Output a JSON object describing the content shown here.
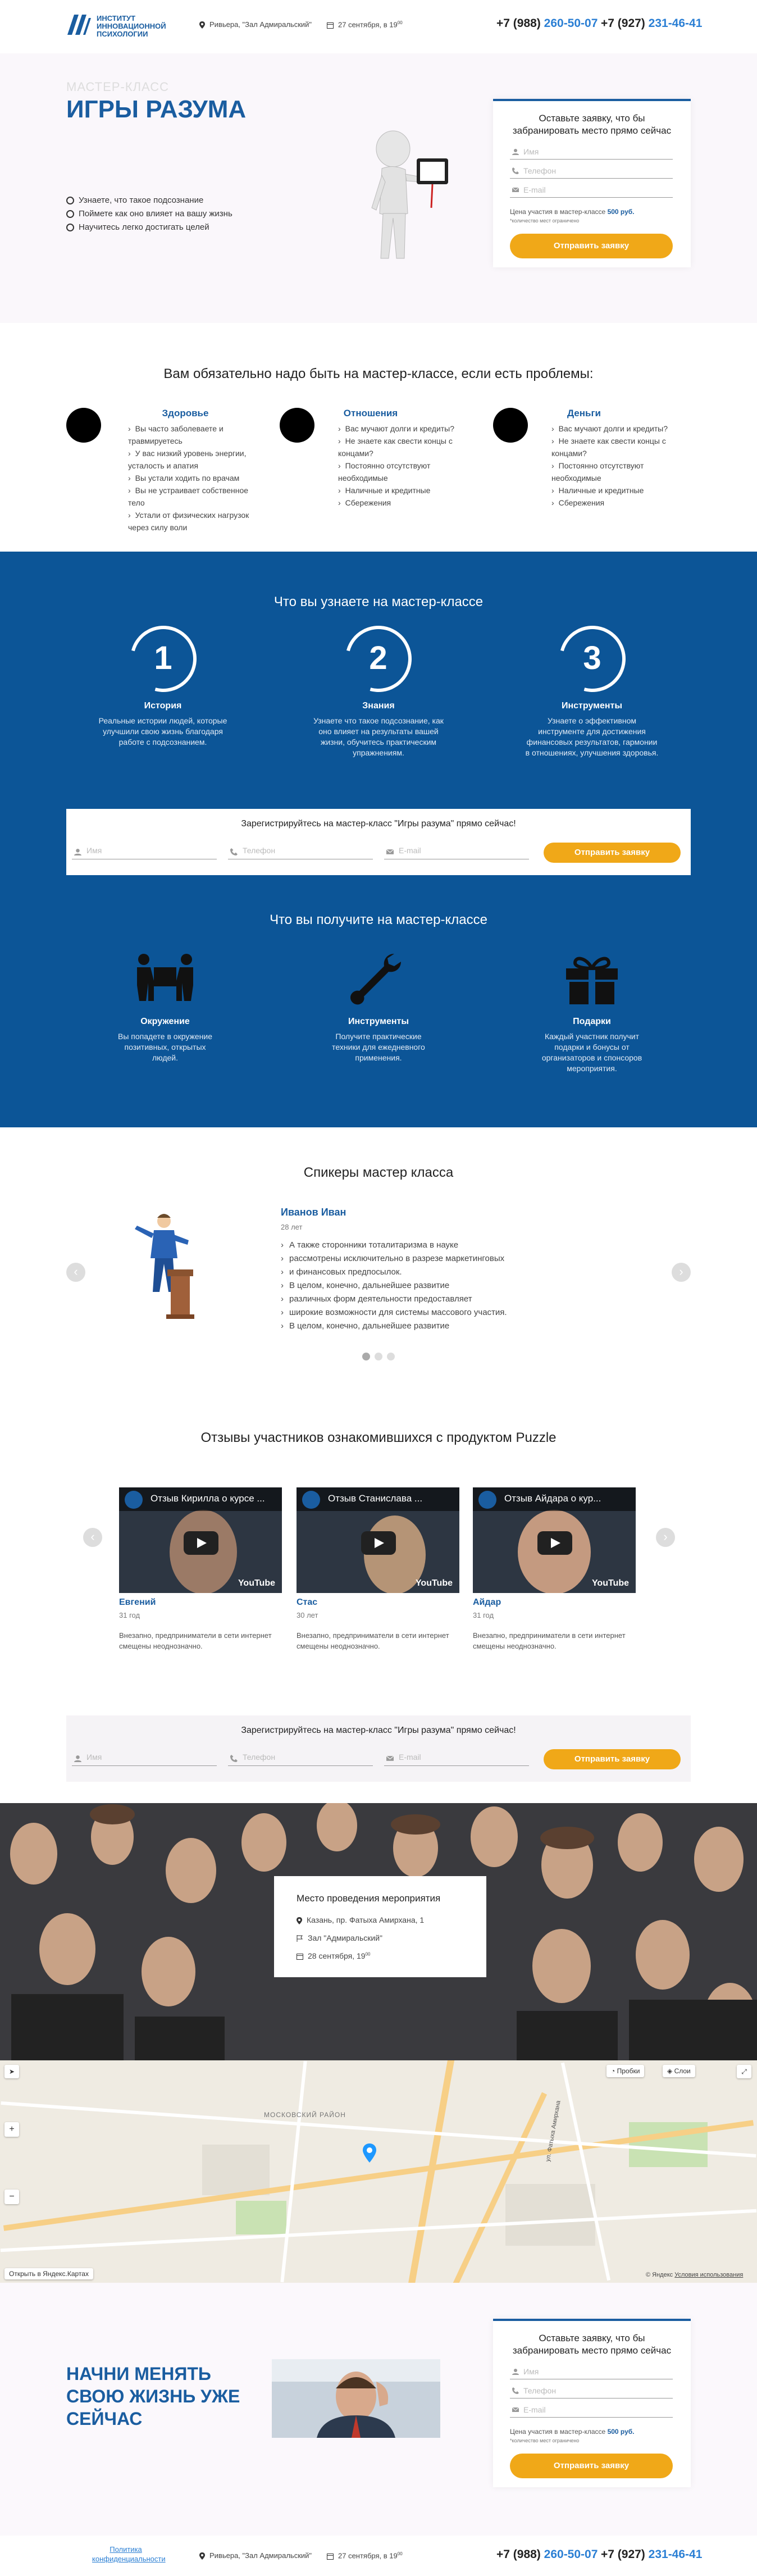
{
  "header": {
    "logo_line1": "ИНСТИТУТ",
    "logo_line2": "ИННОВАЦИОННОЙ",
    "logo_line3": "ПСИХОЛОГИИ",
    "place": "Ривьера, \"Зал Адмиральский\"",
    "date": "27 сентября, в 19",
    "date_sup": "00",
    "phone1_prefix": "+7 (988)",
    "phone1_num": "260-50-07",
    "phone2_prefix": "+7 (927)",
    "phone2_num": "231-46-41"
  },
  "hero": {
    "subtitle": "МАСТЕР-КЛАСС",
    "title": "ИГРЫ РАЗУМА",
    "bullets": [
      "Узнаете, что такое подсознание",
      "Поймете как оно влияет на вашу жизнь",
      "Научитесь легко достигать целей"
    ]
  },
  "form": {
    "title": "Оставьте заявку, что бы забранировать место прямо сейчас",
    "name_placeholder": "Имя",
    "phone_placeholder": "Телефон",
    "email_placeholder": "E-mail",
    "price_text": "Цена участия в мастер-классе",
    "price_value": "500 руб.",
    "note": "*количество мест ограничено",
    "submit": "Отправить заявку"
  },
  "problems": {
    "title": "Вам обязательно надо быть на мастер-классе, если есть проблемы:",
    "items": [
      {
        "title": "Здоровье",
        "points": [
          "Вы часто заболеваете и травмируетесь",
          "У вас низкий уровень энергии, усталость и апатия",
          "Вы устали ходить по врачам",
          "Вы не устраивает собственное тело",
          "Устали от физических нагрузок через силу воли"
        ]
      },
      {
        "title": "Отношения",
        "points": [
          "Вас мучают долги и кредиты?",
          "Не знаете как свести концы с концами?",
          "Постоянно отсутствуют необходимые",
          "Наличные и кредитные",
          "Сбережения"
        ]
      },
      {
        "title": "Деньги",
        "points": [
          "Вас мучают долги и кредиты?",
          "Не знаете как свести концы с концами?",
          "Постоянно отсутствуют необходимые",
          "Наличные и кредитные",
          "Сбережения"
        ]
      }
    ]
  },
  "learn": {
    "title": "Что вы узнаете на мастер-классе",
    "items": [
      {
        "num": "1",
        "title": "История",
        "text": "Реальные истории людей, которые улучшили свою жизнь благодаря работе с подсознанием."
      },
      {
        "num": "2",
        "title": "Знания",
        "text": "Узнаете что такое подсознание, как оно влияет на результаты вашей жизни, обучитесь практическим упражнениям."
      },
      {
        "num": "3",
        "title": "Инструменты",
        "text": "Узнаете о эффективном инструменте для достижения финансовых результатов, гармонии в отношениях, улучшения здоровья."
      }
    ]
  },
  "register": {
    "title": "Зарегистрируйтесь на мастер-класс \"Игры разума\" прямо сейчас!",
    "name_placeholder": "Имя",
    "phone_placeholder": "Телефон",
    "email_placeholder": "E-mail",
    "submit": "Отправить заявку"
  },
  "get": {
    "title": "Что вы получите на мастер-классе",
    "items": [
      {
        "icon": "people-carry-icon",
        "title": "Окружение",
        "text": "Вы попадете в окружение позитивных, открытых людей."
      },
      {
        "icon": "wrench-icon",
        "title": "Инструменты",
        "text": "Получите практические техники для ежедневного применения."
      },
      {
        "icon": "gift-icon",
        "title": "Подарки",
        "text": "Каждый участник получит подарки и бонусы от организаторов и спонсоров мероприятия."
      }
    ]
  },
  "speakers": {
    "title": "Спикеры мастер класса",
    "name": "Иванов Иван",
    "age": "28 лет",
    "points": [
      "А также сторонники тоталитаризма в науке",
      "рассмотрены исключительно в разрезе маркетинговых",
      "и финансовых предпосылок.",
      "В целом, конечно, дальнейшее развитие",
      "различных форм деятельности предоставляет",
      "широкие возможности для системы массового участия.",
      "В целом, конечно, дальнейшее развитие"
    ],
    "prev": "‹",
    "next": "›"
  },
  "reviews": {
    "title": "Отзывы участников ознакомившихся с продуктом Puzzle",
    "items": [
      {
        "video_title": "Отзыв Кирилла о курсе ...",
        "name": "Евгений",
        "age": "31 год",
        "text": "Внезапно, предприниматели в сети интернет смещены неоднозначно."
      },
      {
        "video_title": "Отзыв Станислава ...",
        "name": "Стас",
        "age": "30 лет",
        "text": "Внезапно, предприниматели в сети интернет смещены неоднозначно."
      },
      {
        "video_title": "Отзыв Айдара о кур...",
        "name": "Айдар",
        "age": "31 год",
        "text": "Внезапно, предприниматели в сети интернет смещены неоднозначно."
      }
    ],
    "youtube": "YouTube"
  },
  "venue": {
    "title": "Место проведения мероприятия",
    "address": "Казань, пр. Фатыха Амирхана, 1",
    "hall": "Зал \"Адмиральский\"",
    "date": "28 сентября, 19",
    "date_sup": "00"
  },
  "map": {
    "traffic": "Пробки",
    "layers": "Слои",
    "open_link": "Открыть в Яндекс.Картах",
    "copyright": "© Яндекс",
    "terms": "Условия использования",
    "district": "МОСКОВСКИЙ РАЙОН",
    "street": "ул. Фатыха Амирхана"
  },
  "bottom": {
    "title": "НАЧНИ МЕНЯТЬ СВОЮ ЖИЗНЬ УЖЕ СЕЙЧАС"
  },
  "footer": {
    "privacy": "Политика конфиденциальности",
    "place": "Ривьера, \"Зал Адмиральский\"",
    "date": "27 сентября, в 19",
    "date_sup": "00"
  }
}
